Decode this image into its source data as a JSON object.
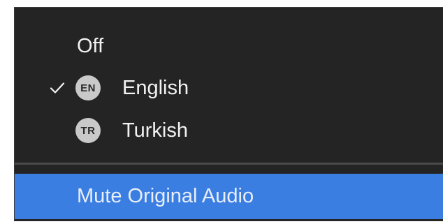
{
  "menu": {
    "items": [
      {
        "label": "Off",
        "checked": false
      },
      {
        "label": "English",
        "badge": "EN",
        "checked": true
      },
      {
        "label": "Turkish",
        "badge": "TR",
        "checked": false
      }
    ],
    "action": {
      "label": "Mute Original Audio",
      "highlighted": true
    }
  },
  "icons": {
    "checkmark": "check-icon"
  },
  "colors": {
    "menu_background": "#242424",
    "text": "#f2f2f2",
    "badge_background": "#c9c9c9",
    "highlight": "#3a7ee2",
    "divider": "#4a4a4a"
  }
}
